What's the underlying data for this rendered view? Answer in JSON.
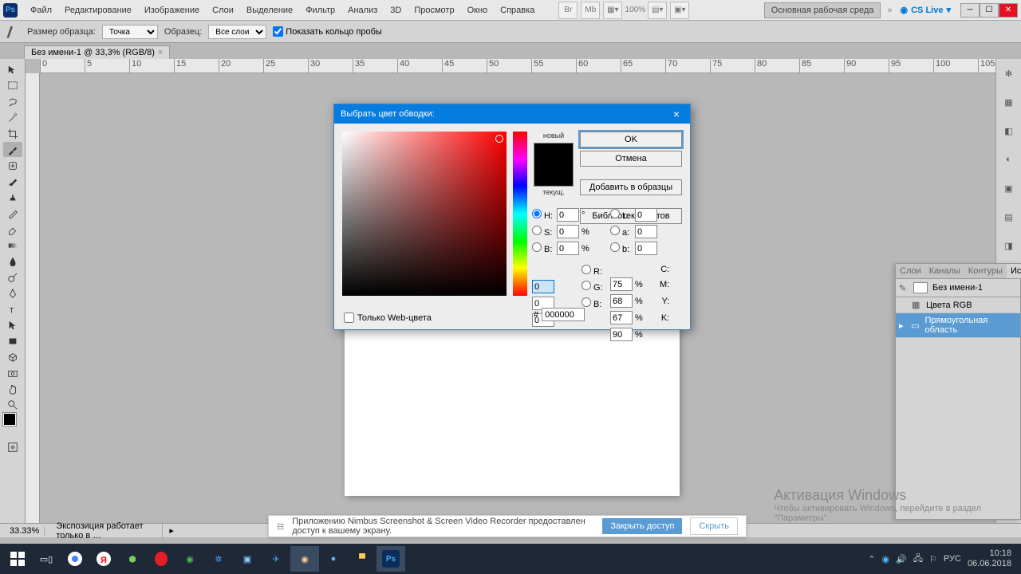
{
  "menubar": {
    "items": [
      "Файл",
      "Редактирование",
      "Изображение",
      "Слои",
      "Выделение",
      "Фильтр",
      "Анализ",
      "3D",
      "Просмотр",
      "Окно",
      "Справка"
    ],
    "zoom": "100%",
    "workspace": "Основная рабочая среда",
    "cslive": "CS Live"
  },
  "optbar": {
    "label_size": "Размер образца:",
    "size_value": "Точка",
    "label_sample": "Образец:",
    "sample_value": "Все слои",
    "show_ring": "Показать кольцо пробы"
  },
  "doctab": {
    "title": "Без имени-1 @ 33,3% (RGB/8)"
  },
  "ruler_marks": [
    "0",
    "5",
    "10",
    "15",
    "20",
    "25",
    "30",
    "35",
    "40",
    "45",
    "50",
    "55",
    "60",
    "65",
    "70",
    "75",
    "80",
    "85",
    "90",
    "95",
    "100",
    "105"
  ],
  "dialog": {
    "title": "Выбрать цвет обводки:",
    "new_label": "новый",
    "current_label": "текущ.",
    "ok": "OK",
    "cancel": "Отмена",
    "add_swatch": "Добавить в образцы",
    "libs": "Библиотеки цветов",
    "webonly": "Только Web-цвета",
    "hsb": {
      "H": "0",
      "S": "0",
      "B": "0"
    },
    "rgb": {
      "R": "0",
      "G": "0",
      "B": "0"
    },
    "lab": {
      "L": "0",
      "a": "0",
      "b": "0"
    },
    "cmyk": {
      "C": "75",
      "M": "68",
      "Y": "67",
      "K": "90"
    },
    "hex": "000000"
  },
  "history": {
    "tabs": [
      "Слои",
      "Каналы",
      "Контуры",
      "История"
    ],
    "doc": "Без имени-1",
    "items": [
      "Цвета RGB",
      "Прямоугольная область"
    ]
  },
  "status": {
    "zoom": "33.33%",
    "info": "Экспозиция работает только в …"
  },
  "notification": {
    "text": "Приложению Nimbus Screenshot & Screen Video Recorder предоставлен доступ к вашему экрану.",
    "close_access": "Закрыть доступ",
    "hide": "Скрыть"
  },
  "watermark": {
    "line1": "Активация Windows",
    "line2": "Чтобы активировать Windows, перейдите в раздел",
    "line3": "\"Параметры\"."
  },
  "tray": {
    "lang": "РУС",
    "time": "10:18",
    "date": "06.06.2018"
  }
}
